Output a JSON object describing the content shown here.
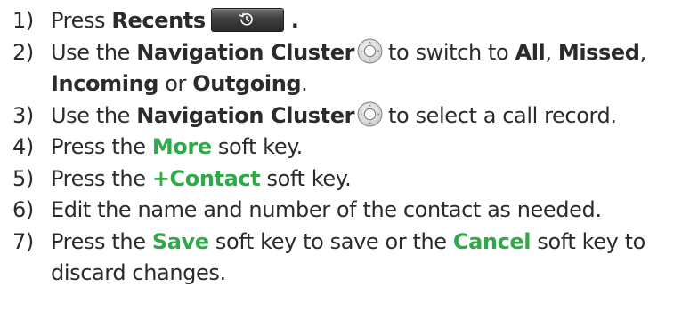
{
  "steps": [
    {
      "num": "1)",
      "parts": [
        {
          "t": "Press "
        },
        {
          "t": "Recents",
          "s": "b"
        },
        {
          "icon": "recents-key-icon"
        },
        {
          "t": ".",
          "s": "b"
        }
      ]
    },
    {
      "num": "2)",
      "parts": [
        {
          "t": "Use the "
        },
        {
          "t": "Navigation Cluster",
          "s": "b"
        },
        {
          "icon": "navigation-cluster-icon"
        },
        {
          "t": "to switch to "
        },
        {
          "t": "All",
          "s": "b"
        },
        {
          "t": ", "
        },
        {
          "t": "Missed",
          "s": "b"
        },
        {
          "t": ","
        },
        {
          "br": true
        },
        {
          "t": "Incoming",
          "s": "b"
        },
        {
          "t": " or "
        },
        {
          "t": "Outgoing",
          "s": "b"
        },
        {
          "t": "."
        }
      ]
    },
    {
      "num": "3)",
      "parts": [
        {
          "t": "Use the "
        },
        {
          "t": "Navigation Cluster",
          "s": "b"
        },
        {
          "icon": "navigation-cluster-icon"
        },
        {
          "t": "to select a call record."
        }
      ]
    },
    {
      "num": "4)",
      "parts": [
        {
          "t": "Press the "
        },
        {
          "t": "More",
          "s": "soft"
        },
        {
          "t": " soft key."
        }
      ]
    },
    {
      "num": "5)",
      "parts": [
        {
          "t": "Press the "
        },
        {
          "t": "+Contact",
          "s": "soft"
        },
        {
          "t": " soft key."
        }
      ]
    },
    {
      "num": "6)",
      "parts": [
        {
          "t": "Edit the name and number of the contact as needed."
        }
      ]
    },
    {
      "num": "7)",
      "parts": [
        {
          "t": "Press the "
        },
        {
          "t": "Save",
          "s": "soft"
        },
        {
          "t": " soft key to save or the "
        },
        {
          "t": "Cancel",
          "s": "soft"
        },
        {
          "t": " soft key to"
        },
        {
          "br": true
        },
        {
          "t": "discard changes."
        }
      ]
    }
  ],
  "colors": {
    "text": "#2b2b2b",
    "softkey": "#33a84a",
    "key_face": "#3f3f3f"
  }
}
